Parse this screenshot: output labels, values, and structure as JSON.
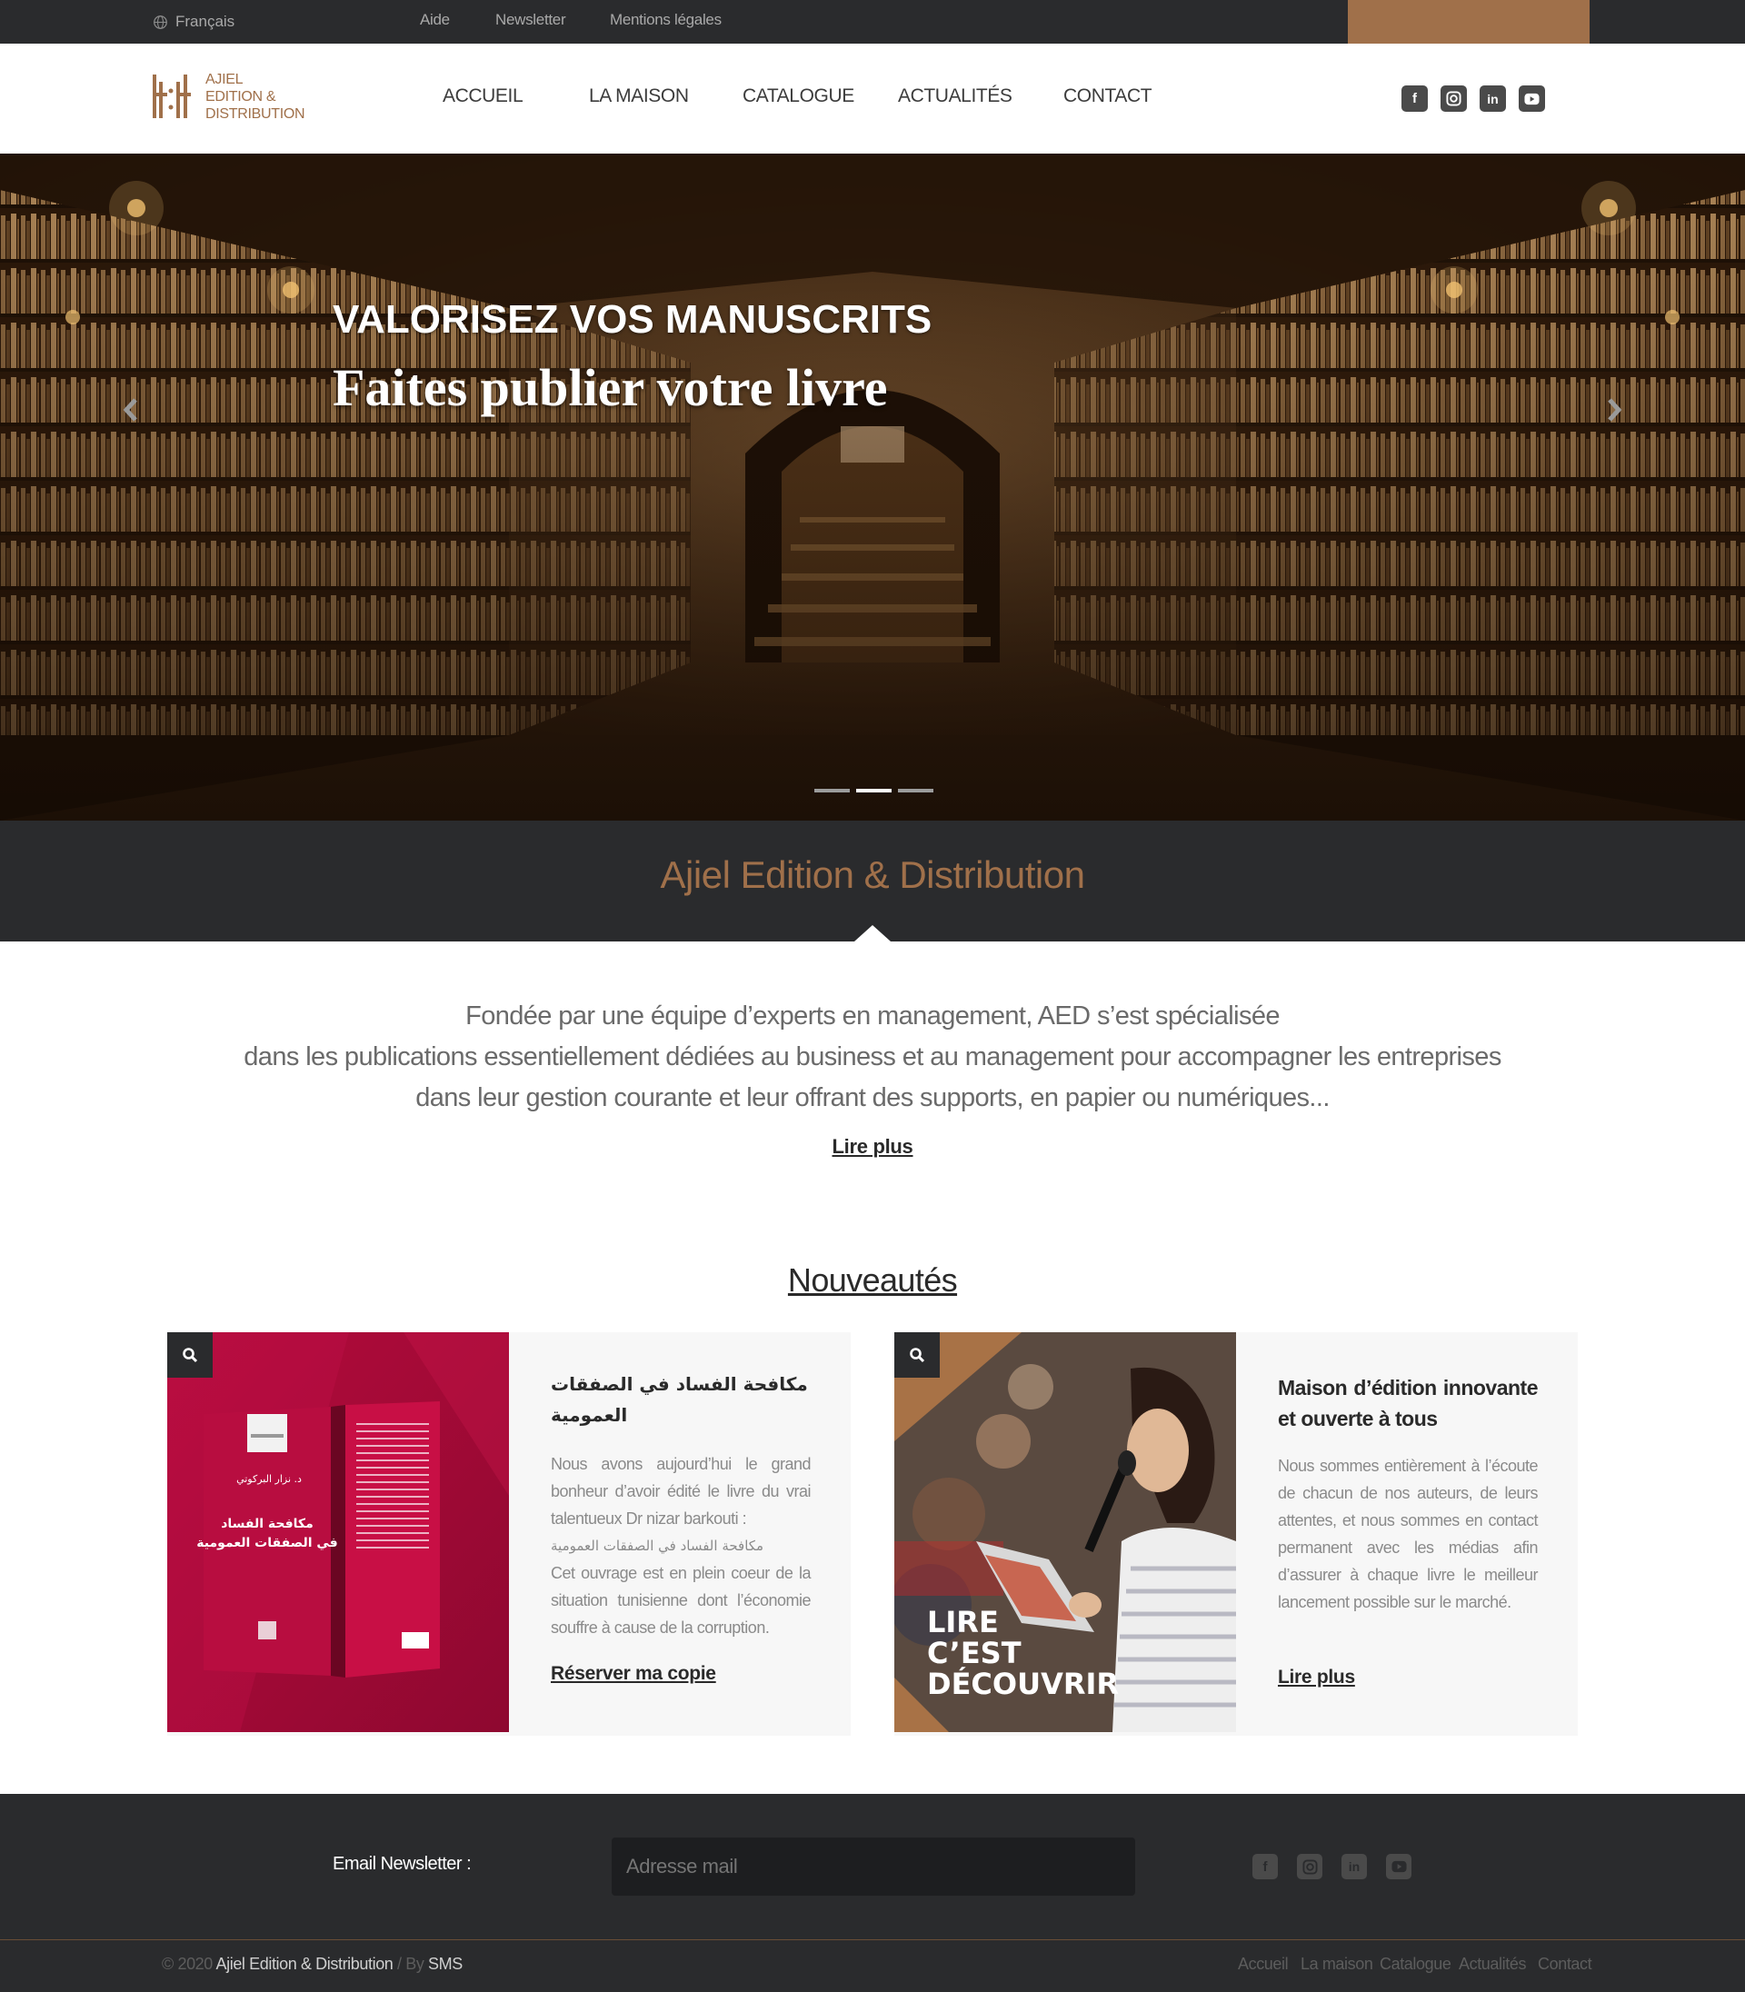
{
  "colors": {
    "accent": "#a0704a",
    "dark": "#2a2b2d",
    "text_muted": "#8a8a8a"
  },
  "topbar": {
    "language": "Français",
    "language_icon": "globe-icon",
    "links": [
      "Aide",
      "Newsletter",
      "Mentions légales"
    ]
  },
  "header": {
    "logo_text": [
      "AJIEL",
      "EDITION &",
      "DISTRIBUTION"
    ],
    "nav": [
      "ACCUEIL",
      "LA MAISON",
      "CATALOGUE",
      "ACTUALITÉS",
      "CONTACT"
    ],
    "social_icons": [
      "facebook-icon",
      "instagram-icon",
      "linkedin-icon",
      "youtube-icon"
    ]
  },
  "hero": {
    "title": "VALORISEZ VOS MANUSCRITS",
    "subtitle": "Faites publier votre livre",
    "slide_count": 3,
    "active_slide": 2
  },
  "band": {
    "title": "Ajiel Edition & Distribution"
  },
  "about": {
    "lines": [
      "Fondée par une équipe d’experts en management, AED s’est spécialisée",
      "dans les publications essentiellement dédiées au business et au management pour accompagner les entreprises",
      "dans leur gestion courante et leur offrant des supports, en papier ou numériques..."
    ],
    "read_more": "Lire plus"
  },
  "nouveautes": {
    "title": "Nouveautés",
    "cards": [
      {
        "title": "مكافحة الفساد في الصفقات العمومية",
        "text_lines": [
          "Nous avons aujourd’hui le grand bonheur d’avoir édité le livre du vrai talentueux Dr nizar barkouti :",
          "مكافحة الفساد في الصفقات العمومية",
          "Cet ouvrage est en plein coeur de la situation tunisienne dont l’économie souffre à cause de la corruption."
        ],
        "link": "Réserver ma copie",
        "book_title": [
          "مكافحة الفساد",
          "في الصفقات العمومية"
        ],
        "book_author": "د. نزار البركوتي"
      },
      {
        "title": "Maison d’édition innovante et ouverte à tous",
        "text": "Nous sommes entièrement à l’écoute de chacun de nos auteurs, de leurs attentes, et nous sommes en contact permanent avec les médias afin d’assurer à chaque livre le meilleur lancement possible sur le marché.",
        "link": "Lire plus",
        "image_caption": [
          "LIRE",
          "C’EST",
          "DÉCOUVRIR"
        ]
      }
    ]
  },
  "footer": {
    "newsletter_label": "Email Newsletter :",
    "newsletter_placeholder": "Adresse mail",
    "copyright_prefix": "© 2020 ",
    "copyright_brand": "Ajiel Edition & Distribution",
    "copyright_by": " / By ",
    "copyright_agency": "SMS",
    "nav": [
      "Accueil",
      "La maison",
      "Catalogue",
      "Actualités",
      "Contact"
    ]
  }
}
